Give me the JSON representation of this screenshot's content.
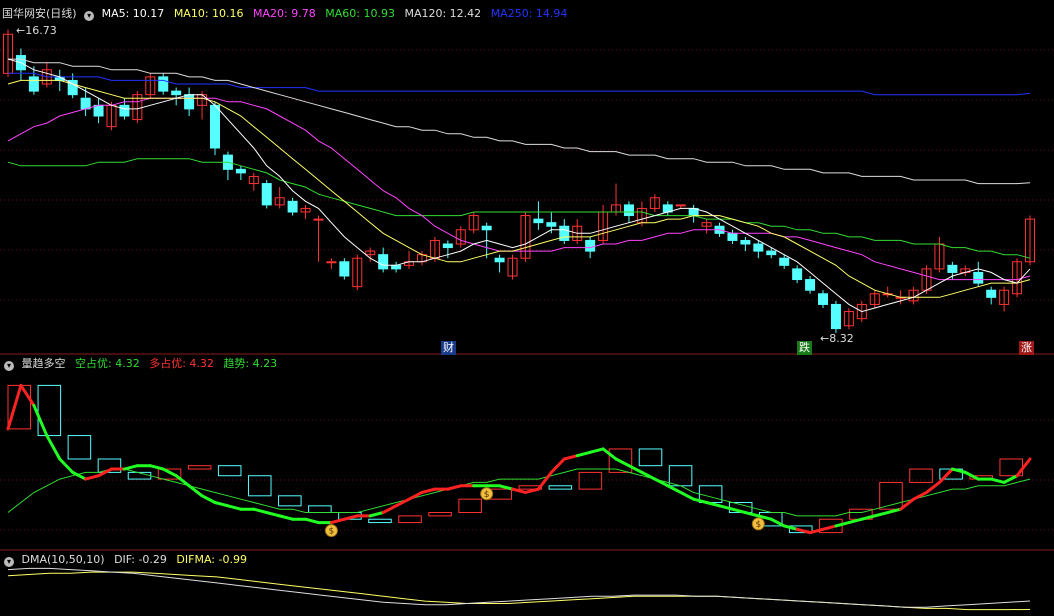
{
  "panel1": {
    "title": "国华网安(日线)",
    "ma_labels": [
      {
        "text": "MA5: 10.17",
        "color": "#ffffff"
      },
      {
        "text": "MA10: 10.16",
        "color": "#ffff66"
      },
      {
        "text": "MA20: 9.78",
        "color": "#ff44ff"
      },
      {
        "text": "MA60: 10.93",
        "color": "#33dd33"
      },
      {
        "text": "MA120: 12.42",
        "color": "#dddddd"
      },
      {
        "text": "MA250: 14.94",
        "color": "#2233ff"
      }
    ],
    "high_label": "16.73",
    "low_label": "8.32",
    "markers": {
      "cai": "财",
      "die": "跌",
      "zhang": "涨"
    }
  },
  "panel2": {
    "title": "量趋多空",
    "labels": [
      {
        "text": "空占优: 4.32",
        "color": "#33dd33"
      },
      {
        "text": "多占优: 4.32",
        "color": "#ff3333"
      },
      {
        "text": "趋势: 4.23",
        "color": "#33dd33"
      }
    ]
  },
  "panel3": {
    "title": "DMA(10,50,10)",
    "labels": [
      {
        "text": "DIF: -0.29",
        "color": "#dddddd"
      },
      {
        "text": "DIFMA: -0.99",
        "color": "#ffff66"
      }
    ]
  },
  "chart_data": {
    "type": "candlestick",
    "colors": {
      "up": "#ff3333",
      "down": "#55ffff",
      "ma5": "#ffffff",
      "ma10": "#ffff66",
      "ma20": "#ff44ff",
      "ma60": "#33dd33",
      "ma120": "#dddddd",
      "ma250": "#2233ff"
    },
    "ylim": [
      8.0,
      17.0
    ],
    "candles": [
      [
        15.5,
        16.6,
        15.4,
        16.73
      ],
      [
        16.0,
        15.6,
        15.3,
        16.2
      ],
      [
        15.4,
        15.0,
        14.9,
        15.7
      ],
      [
        15.2,
        15.6,
        15.1,
        15.8
      ],
      [
        15.4,
        15.3,
        15.0,
        15.6
      ],
      [
        15.3,
        14.9,
        14.8,
        15.5
      ],
      [
        14.8,
        14.5,
        14.3,
        15.1
      ],
      [
        14.6,
        14.3,
        14.1,
        14.8
      ],
      [
        14.0,
        14.6,
        13.9,
        14.7
      ],
      [
        14.6,
        14.3,
        14.2,
        14.8
      ],
      [
        14.2,
        14.9,
        14.1,
        15.0
      ],
      [
        14.9,
        15.4,
        14.8,
        15.5
      ],
      [
        15.4,
        15.0,
        14.9,
        15.5
      ],
      [
        15.0,
        14.9,
        14.6,
        15.1
      ],
      [
        14.9,
        14.5,
        14.3,
        15.1
      ],
      [
        14.6,
        14.9,
        14.2,
        15.0
      ],
      [
        14.6,
        13.4,
        13.2,
        14.7
      ],
      [
        13.2,
        12.8,
        12.5,
        13.3
      ],
      [
        12.8,
        12.7,
        12.5,
        12.9
      ],
      [
        12.4,
        12.6,
        12.2,
        12.7
      ],
      [
        12.4,
        11.8,
        11.7,
        12.5
      ],
      [
        11.8,
        12.0,
        11.7,
        12.3
      ],
      [
        11.9,
        11.6,
        11.5,
        12.0
      ],
      [
        11.6,
        11.7,
        11.4,
        11.8
      ],
      [
        11.4,
        11.4,
        10.2,
        11.5
      ],
      [
        10.2,
        10.2,
        10.0,
        10.3
      ],
      [
        10.2,
        9.8,
        9.7,
        10.3
      ],
      [
        9.5,
        10.3,
        9.4,
        10.4
      ],
      [
        10.4,
        10.5,
        10.2,
        10.6
      ],
      [
        10.4,
        10.0,
        9.9,
        10.6
      ],
      [
        10.1,
        10.0,
        9.9,
        10.2
      ],
      [
        10.1,
        10.2,
        10.0,
        10.5
      ],
      [
        10.2,
        10.4,
        10.1,
        10.5
      ],
      [
        10.3,
        10.8,
        10.2,
        10.9
      ],
      [
        10.7,
        10.6,
        10.3,
        10.8
      ],
      [
        10.7,
        11.1,
        10.6,
        11.2
      ],
      [
        11.1,
        11.5,
        11.0,
        11.6
      ],
      [
        11.2,
        11.1,
        10.3,
        11.3
      ],
      [
        10.3,
        10.2,
        9.9,
        10.4
      ],
      [
        9.8,
        10.3,
        9.7,
        10.4
      ],
      [
        10.3,
        11.5,
        10.2,
        11.6
      ],
      [
        11.4,
        11.3,
        11.1,
        11.9
      ],
      [
        11.3,
        11.2,
        11.0,
        11.6
      ],
      [
        11.2,
        10.8,
        10.7,
        11.4
      ],
      [
        10.8,
        11.2,
        10.7,
        11.4
      ],
      [
        10.8,
        10.5,
        10.3,
        10.9
      ],
      [
        10.8,
        11.6,
        10.7,
        11.8
      ],
      [
        11.6,
        11.8,
        11.5,
        12.4
      ],
      [
        11.8,
        11.5,
        11.3,
        11.9
      ],
      [
        11.3,
        11.7,
        11.2,
        11.9
      ],
      [
        11.7,
        12.0,
        11.6,
        12.1
      ],
      [
        11.8,
        11.6,
        11.5,
        11.9
      ],
      [
        11.8,
        11.8,
        11.7,
        11.8
      ],
      [
        11.7,
        11.5,
        11.3,
        11.8
      ],
      [
        11.2,
        11.3,
        11.0,
        11.4
      ],
      [
        11.2,
        11.0,
        10.9,
        11.3
      ],
      [
        11.0,
        10.8,
        10.7,
        11.1
      ],
      [
        10.8,
        10.7,
        10.5,
        10.9
      ],
      [
        10.7,
        10.5,
        10.3,
        10.8
      ],
      [
        10.5,
        10.4,
        10.3,
        10.6
      ],
      [
        10.3,
        10.1,
        10.0,
        10.4
      ],
      [
        10.0,
        9.7,
        9.6,
        10.1
      ],
      [
        9.7,
        9.4,
        9.3,
        9.8
      ],
      [
        9.3,
        9.0,
        8.9,
        9.4
      ],
      [
        9.0,
        8.32,
        8.2,
        9.1
      ],
      [
        8.4,
        8.8,
        8.3,
        8.9
      ],
      [
        8.6,
        9.0,
        8.5,
        9.1
      ],
      [
        9.0,
        9.3,
        8.9,
        9.4
      ],
      [
        9.3,
        9.3,
        9.2,
        9.5
      ],
      [
        9.2,
        9.2,
        9.0,
        9.4
      ],
      [
        9.1,
        9.4,
        9.0,
        9.5
      ],
      [
        9.4,
        10.0,
        9.3,
        10.1
      ],
      [
        10.0,
        10.7,
        9.9,
        10.9
      ],
      [
        10.1,
        9.9,
        9.7,
        10.2
      ],
      [
        9.9,
        10.0,
        9.8,
        10.1
      ],
      [
        9.9,
        9.6,
        9.5,
        10.2
      ],
      [
        9.4,
        9.2,
        9.0,
        9.5
      ],
      [
        9.0,
        9.4,
        8.8,
        9.5
      ],
      [
        9.3,
        10.2,
        9.2,
        10.3
      ],
      [
        10.2,
        11.4,
        10.1,
        11.5
      ]
    ],
    "ma5": [
      15.9,
      15.8,
      15.6,
      15.5,
      15.4,
      15.2,
      15.0,
      14.8,
      14.6,
      14.5,
      14.5,
      14.6,
      14.7,
      14.8,
      14.9,
      14.9,
      14.6,
      14.2,
      13.8,
      13.4,
      12.9,
      12.6,
      12.2,
      11.9,
      11.7,
      11.3,
      10.9,
      10.6,
      10.3,
      10.1,
      10.1,
      10.2,
      10.2,
      10.3,
      10.4,
      10.5,
      10.7,
      10.8,
      10.7,
      10.6,
      10.7,
      10.9,
      11.1,
      11.1,
      11.0,
      11.0,
      11.1,
      11.2,
      11.3,
      11.4,
      11.5,
      11.6,
      11.7,
      11.7,
      11.6,
      11.4,
      11.2,
      11.0,
      10.8,
      10.6,
      10.4,
      10.2,
      9.9,
      9.6,
      9.3,
      9.0,
      8.8,
      8.9,
      9.0,
      9.1,
      9.2,
      9.4,
      9.6,
      9.8,
      9.9,
      10.0,
      9.9,
      9.7,
      9.6,
      10.0
    ],
    "ma10": [
      15.2,
      15.3,
      15.3,
      15.3,
      15.3,
      15.2,
      15.1,
      15.0,
      14.9,
      14.8,
      14.8,
      14.8,
      14.8,
      14.8,
      14.8,
      14.8,
      14.7,
      14.5,
      14.3,
      14.0,
      13.7,
      13.4,
      13.1,
      12.8,
      12.5,
      12.2,
      11.9,
      11.6,
      11.3,
      11.0,
      10.8,
      10.6,
      10.4,
      10.3,
      10.2,
      10.2,
      10.3,
      10.4,
      10.5,
      10.5,
      10.6,
      10.7,
      10.8,
      10.9,
      10.9,
      10.9,
      11.0,
      11.1,
      11.2,
      11.3,
      11.3,
      11.4,
      11.4,
      11.5,
      11.5,
      11.5,
      11.4,
      11.3,
      11.2,
      11.0,
      10.9,
      10.7,
      10.5,
      10.3,
      10.1,
      9.8,
      9.6,
      9.4,
      9.3,
      9.2,
      9.2,
      9.2,
      9.2,
      9.3,
      9.4,
      9.5,
      9.6,
      9.6,
      9.6,
      9.7
    ],
    "ma20": [
      13.6,
      13.8,
      14.0,
      14.1,
      14.3,
      14.4,
      14.5,
      14.6,
      14.6,
      14.7,
      14.7,
      14.8,
      14.8,
      14.8,
      14.8,
      14.8,
      14.8,
      14.7,
      14.7,
      14.6,
      14.5,
      14.3,
      14.1,
      13.9,
      13.6,
      13.4,
      13.1,
      12.8,
      12.5,
      12.2,
      12.0,
      11.7,
      11.5,
      11.2,
      11.0,
      10.8,
      10.7,
      10.6,
      10.5,
      10.5,
      10.5,
      10.5,
      10.5,
      10.6,
      10.6,
      10.6,
      10.7,
      10.7,
      10.8,
      10.8,
      10.9,
      11.0,
      11.0,
      11.1,
      11.1,
      11.1,
      11.0,
      11.0,
      11.0,
      11.0,
      10.9,
      10.9,
      10.8,
      10.7,
      10.6,
      10.5,
      10.4,
      10.2,
      10.1,
      10.0,
      9.9,
      9.8,
      9.7,
      9.7,
      9.7,
      9.7,
      9.7,
      9.7,
      9.7,
      9.8
    ],
    "ma60": [
      13.0,
      12.9,
      12.9,
      12.9,
      12.9,
      12.9,
      12.9,
      13.0,
      13.0,
      13.0,
      13.1,
      13.1,
      13.1,
      13.1,
      13.1,
      13.0,
      13.0,
      13.0,
      12.9,
      12.8,
      12.7,
      12.5,
      12.4,
      12.3,
      12.1,
      12.0,
      11.9,
      11.8,
      11.7,
      11.6,
      11.5,
      11.5,
      11.5,
      11.5,
      11.5,
      11.5,
      11.6,
      11.6,
      11.6,
      11.6,
      11.6,
      11.6,
      11.6,
      11.6,
      11.6,
      11.6,
      11.6,
      11.6,
      11.6,
      11.6,
      11.5,
      11.5,
      11.5,
      11.5,
      11.4,
      11.4,
      11.4,
      11.3,
      11.3,
      11.2,
      11.2,
      11.1,
      11.1,
      11.0,
      11.0,
      10.9,
      10.9,
      10.8,
      10.8,
      10.8,
      10.7,
      10.7,
      10.7,
      10.6,
      10.6,
      10.5,
      10.5,
      10.4,
      10.4,
      10.3
    ],
    "ma120": [
      15.9,
      15.9,
      15.8,
      15.8,
      15.8,
      15.7,
      15.7,
      15.7,
      15.6,
      15.6,
      15.6,
      15.5,
      15.5,
      15.5,
      15.4,
      15.4,
      15.3,
      15.3,
      15.2,
      15.1,
      15.0,
      14.9,
      14.8,
      14.7,
      14.6,
      14.5,
      14.4,
      14.3,
      14.2,
      14.1,
      14.0,
      14.0,
      13.9,
      13.9,
      13.8,
      13.8,
      13.7,
      13.7,
      13.6,
      13.6,
      13.5,
      13.5,
      13.5,
      13.4,
      13.4,
      13.3,
      13.3,
      13.3,
      13.2,
      13.2,
      13.2,
      13.1,
      13.1,
      13.1,
      13.0,
      13.0,
      13.0,
      12.9,
      12.9,
      12.9,
      12.8,
      12.8,
      12.8,
      12.7,
      12.7,
      12.7,
      12.6,
      12.6,
      12.6,
      12.6,
      12.5,
      12.5,
      12.5,
      12.5,
      12.5,
      12.4,
      12.4,
      12.4,
      12.4,
      12.42
    ],
    "ma250": [
      15.5,
      15.5,
      15.5,
      15.4,
      15.4,
      15.4,
      15.4,
      15.4,
      15.3,
      15.3,
      15.3,
      15.3,
      15.3,
      15.2,
      15.2,
      15.2,
      15.2,
      15.2,
      15.1,
      15.1,
      15.1,
      15.1,
      15.1,
      15.1,
      15.0,
      15.0,
      15.0,
      15.0,
      15.0,
      15.0,
      15.0,
      15.0,
      15.0,
      15.0,
      15.0,
      15.0,
      15.0,
      15.0,
      15.0,
      15.0,
      15.0,
      15.0,
      15.0,
      15.0,
      15.0,
      15.0,
      15.0,
      15.0,
      15.0,
      15.0,
      15.0,
      15.0,
      15.0,
      15.0,
      15.0,
      15.0,
      15.0,
      15.0,
      15.0,
      15.0,
      15.0,
      15.0,
      15.0,
      15.0,
      15.0,
      15.0,
      15.0,
      14.9,
      14.9,
      14.9,
      14.9,
      14.9,
      14.9,
      14.9,
      14.9,
      14.9,
      14.9,
      14.9,
      14.9,
      14.94
    ],
    "trend_line": [
      3.5,
      4.8,
      4.2,
      3.3,
      2.6,
      2.2,
      2.0,
      2.1,
      2.3,
      2.3,
      2.4,
      2.4,
      2.3,
      2.1,
      1.8,
      1.5,
      1.3,
      1.2,
      1.1,
      1.1,
      1.0,
      0.9,
      0.8,
      0.8,
      0.7,
      0.7,
      0.8,
      0.9,
      0.9,
      1.0,
      1.2,
      1.4,
      1.6,
      1.7,
      1.7,
      1.8,
      1.8,
      1.8,
      1.8,
      1.7,
      1.6,
      1.7,
      2.2,
      2.6,
      2.7,
      2.8,
      2.9,
      2.6,
      2.4,
      2.2,
      2.0,
      1.8,
      1.6,
      1.4,
      1.3,
      1.2,
      1.1,
      1.0,
      0.9,
      0.8,
      0.6,
      0.5,
      0.4,
      0.5,
      0.6,
      0.7,
      0.8,
      0.9,
      1.0,
      1.1,
      1.4,
      1.6,
      1.9,
      2.3,
      2.2,
      2.0,
      2.0,
      1.9,
      2.1,
      2.6
    ],
    "trend_color": [
      1,
      1,
      0,
      0,
      0,
      0,
      1,
      1,
      1,
      0,
      0,
      0,
      0,
      0,
      0,
      0,
      0,
      0,
      0,
      0,
      0,
      0,
      0,
      0,
      0,
      1,
      1,
      1,
      0,
      1,
      1,
      1,
      1,
      1,
      1,
      1,
      0,
      0,
      0,
      1,
      1,
      1,
      1,
      1,
      0,
      0,
      0,
      0,
      0,
      0,
      0,
      0,
      0,
      0,
      0,
      0,
      0,
      0,
      0,
      0,
      0,
      1,
      1,
      1,
      0,
      0,
      0,
      0,
      0,
      1,
      1,
      1,
      1,
      0,
      0,
      0,
      0,
      0,
      1,
      1
    ],
    "slow_line": [
      1.0,
      1.3,
      1.6,
      1.8,
      2.0,
      2.1,
      2.2,
      2.2,
      2.3,
      2.3,
      2.2,
      2.1,
      2.0,
      1.9,
      1.8,
      1.7,
      1.6,
      1.5,
      1.4,
      1.3,
      1.2,
      1.1,
      1.1,
      1.0,
      1.0,
      1.0,
      1.0,
      1.0,
      1.1,
      1.2,
      1.3,
      1.4,
      1.5,
      1.6,
      1.7,
      1.8,
      1.9,
      1.9,
      2.0,
      2.0,
      2.0,
      2.0,
      2.1,
      2.2,
      2.3,
      2.3,
      2.3,
      2.3,
      2.2,
      2.1,
      2.0,
      1.9,
      1.8,
      1.6,
      1.5,
      1.4,
      1.3,
      1.2,
      1.1,
      1.0,
      1.0,
      0.9,
      0.9,
      0.9,
      0.9,
      1.0,
      1.0,
      1.1,
      1.2,
      1.3,
      1.4,
      1.5,
      1.6,
      1.7,
      1.7,
      1.8,
      1.8,
      1.8,
      1.9,
      2.0
    ],
    "vol_boxes": [
      [
        3.5,
        4.8,
        1
      ],
      [
        4.8,
        3.3,
        0
      ],
      [
        3.3,
        2.6,
        0
      ],
      [
        2.6,
        2.2,
        0
      ],
      [
        2.2,
        2.0,
        0
      ],
      [
        2.0,
        2.3,
        1
      ],
      [
        2.3,
        2.4,
        1
      ],
      [
        2.4,
        2.1,
        0
      ],
      [
        2.1,
        1.5,
        0
      ],
      [
        1.5,
        1.2,
        0
      ],
      [
        1.2,
        1.0,
        0
      ],
      [
        1.0,
        0.8,
        0
      ],
      [
        0.8,
        0.7,
        0
      ],
      [
        0.7,
        0.9,
        1
      ],
      [
        0.9,
        1.0,
        1
      ],
      [
        1.0,
        1.4,
        1
      ],
      [
        1.4,
        1.7,
        1
      ],
      [
        1.7,
        1.8,
        1
      ],
      [
        1.8,
        1.7,
        0
      ],
      [
        1.7,
        2.2,
        1
      ],
      [
        2.2,
        2.9,
        1
      ],
      [
        2.9,
        2.4,
        0
      ],
      [
        2.4,
        1.8,
        0
      ],
      [
        1.8,
        1.3,
        0
      ],
      [
        1.3,
        1.0,
        0
      ],
      [
        1.0,
        0.6,
        0
      ],
      [
        0.6,
        0.4,
        0
      ],
      [
        0.4,
        0.8,
        1
      ],
      [
        0.8,
        1.1,
        1
      ],
      [
        1.1,
        1.9,
        1
      ],
      [
        1.9,
        2.3,
        1
      ],
      [
        2.3,
        2.0,
        0
      ],
      [
        2.0,
        2.1,
        1
      ],
      [
        2.1,
        2.6,
        1
      ]
    ],
    "money_bags_at": [
      25,
      37,
      58
    ],
    "dif": [
      2.3,
      2.4,
      2.4,
      2.3,
      2.2,
      2.1,
      2.0,
      1.8,
      1.6,
      1.4,
      1.2,
      1.0,
      0.8,
      0.6,
      0.4,
      0.2,
      0.0,
      -0.2,
      -0.4,
      -0.5,
      -0.6,
      -0.6,
      -0.5,
      -0.4,
      -0.3,
      -0.2,
      -0.1,
      0.0,
      0.1,
      0.1,
      0.2,
      0.2,
      0.2,
      0.1,
      0.1,
      0.0,
      -0.1,
      -0.2,
      -0.3,
      -0.4,
      -0.5,
      -0.6,
      -0.7,
      -0.8,
      -0.8,
      -0.7,
      -0.6,
      -0.5,
      -0.4,
      -0.29
    ],
    "difma": [
      1.8,
      1.9,
      2.0,
      2.0,
      2.1,
      2.1,
      2.1,
      2.0,
      1.9,
      1.8,
      1.7,
      1.5,
      1.3,
      1.1,
      0.9,
      0.7,
      0.5,
      0.3,
      0.1,
      -0.1,
      -0.3,
      -0.4,
      -0.5,
      -0.5,
      -0.5,
      -0.4,
      -0.3,
      -0.2,
      -0.1,
      0.0,
      0.1,
      0.1,
      0.1,
      0.1,
      0.1,
      0.0,
      -0.1,
      -0.2,
      -0.3,
      -0.4,
      -0.5,
      -0.6,
      -0.7,
      -0.8,
      -0.9,
      -0.9,
      -1.0,
      -1.0,
      -1.0,
      -0.99
    ]
  }
}
